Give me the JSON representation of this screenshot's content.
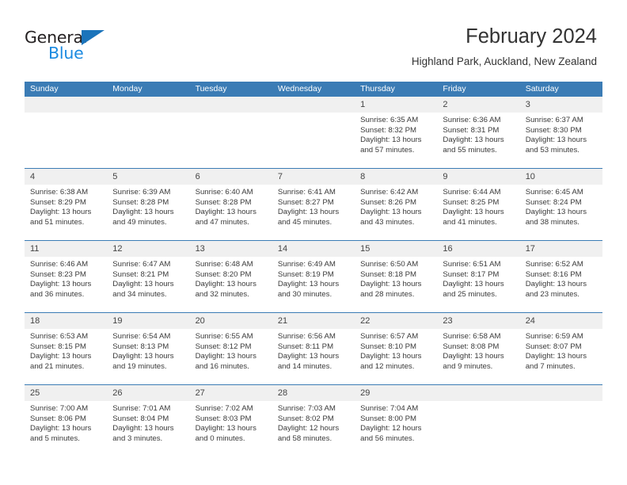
{
  "brand": {
    "name_part1": "General",
    "name_part2": "Blue",
    "accent_color": "#1b8ae0",
    "triangle_color": "#1b74bb"
  },
  "header": {
    "title": "February 2024",
    "subtitle": "Highland Park, Auckland, New Zealand"
  },
  "theme": {
    "header_blue": "#3b7cb5",
    "daynum_band": "#f0f0f0",
    "text": "#333333"
  },
  "calendar": {
    "day_headers": [
      "Sunday",
      "Monday",
      "Tuesday",
      "Wednesday",
      "Thursday",
      "Friday",
      "Saturday"
    ],
    "weeks": [
      [
        {
          "day": "",
          "lines": [
            "",
            "",
            "",
            ""
          ]
        },
        {
          "day": "",
          "lines": [
            "",
            "",
            "",
            ""
          ]
        },
        {
          "day": "",
          "lines": [
            "",
            "",
            "",
            ""
          ]
        },
        {
          "day": "",
          "lines": [
            "",
            "",
            "",
            ""
          ]
        },
        {
          "day": "1",
          "lines": [
            "Sunrise: 6:35 AM",
            "Sunset: 8:32 PM",
            "Daylight: 13 hours",
            "and 57 minutes."
          ]
        },
        {
          "day": "2",
          "lines": [
            "Sunrise: 6:36 AM",
            "Sunset: 8:31 PM",
            "Daylight: 13 hours",
            "and 55 minutes."
          ]
        },
        {
          "day": "3",
          "lines": [
            "Sunrise: 6:37 AM",
            "Sunset: 8:30 PM",
            "Daylight: 13 hours",
            "and 53 minutes."
          ]
        }
      ],
      [
        {
          "day": "4",
          "lines": [
            "Sunrise: 6:38 AM",
            "Sunset: 8:29 PM",
            "Daylight: 13 hours",
            "and 51 minutes."
          ]
        },
        {
          "day": "5",
          "lines": [
            "Sunrise: 6:39 AM",
            "Sunset: 8:28 PM",
            "Daylight: 13 hours",
            "and 49 minutes."
          ]
        },
        {
          "day": "6",
          "lines": [
            "Sunrise: 6:40 AM",
            "Sunset: 8:28 PM",
            "Daylight: 13 hours",
            "and 47 minutes."
          ]
        },
        {
          "day": "7",
          "lines": [
            "Sunrise: 6:41 AM",
            "Sunset: 8:27 PM",
            "Daylight: 13 hours",
            "and 45 minutes."
          ]
        },
        {
          "day": "8",
          "lines": [
            "Sunrise: 6:42 AM",
            "Sunset: 8:26 PM",
            "Daylight: 13 hours",
            "and 43 minutes."
          ]
        },
        {
          "day": "9",
          "lines": [
            "Sunrise: 6:44 AM",
            "Sunset: 8:25 PM",
            "Daylight: 13 hours",
            "and 41 minutes."
          ]
        },
        {
          "day": "10",
          "lines": [
            "Sunrise: 6:45 AM",
            "Sunset: 8:24 PM",
            "Daylight: 13 hours",
            "and 38 minutes."
          ]
        }
      ],
      [
        {
          "day": "11",
          "lines": [
            "Sunrise: 6:46 AM",
            "Sunset: 8:23 PM",
            "Daylight: 13 hours",
            "and 36 minutes."
          ]
        },
        {
          "day": "12",
          "lines": [
            "Sunrise: 6:47 AM",
            "Sunset: 8:21 PM",
            "Daylight: 13 hours",
            "and 34 minutes."
          ]
        },
        {
          "day": "13",
          "lines": [
            "Sunrise: 6:48 AM",
            "Sunset: 8:20 PM",
            "Daylight: 13 hours",
            "and 32 minutes."
          ]
        },
        {
          "day": "14",
          "lines": [
            "Sunrise: 6:49 AM",
            "Sunset: 8:19 PM",
            "Daylight: 13 hours",
            "and 30 minutes."
          ]
        },
        {
          "day": "15",
          "lines": [
            "Sunrise: 6:50 AM",
            "Sunset: 8:18 PM",
            "Daylight: 13 hours",
            "and 28 minutes."
          ]
        },
        {
          "day": "16",
          "lines": [
            "Sunrise: 6:51 AM",
            "Sunset: 8:17 PM",
            "Daylight: 13 hours",
            "and 25 minutes."
          ]
        },
        {
          "day": "17",
          "lines": [
            "Sunrise: 6:52 AM",
            "Sunset: 8:16 PM",
            "Daylight: 13 hours",
            "and 23 minutes."
          ]
        }
      ],
      [
        {
          "day": "18",
          "lines": [
            "Sunrise: 6:53 AM",
            "Sunset: 8:15 PM",
            "Daylight: 13 hours",
            "and 21 minutes."
          ]
        },
        {
          "day": "19",
          "lines": [
            "Sunrise: 6:54 AM",
            "Sunset: 8:13 PM",
            "Daylight: 13 hours",
            "and 19 minutes."
          ]
        },
        {
          "day": "20",
          "lines": [
            "Sunrise: 6:55 AM",
            "Sunset: 8:12 PM",
            "Daylight: 13 hours",
            "and 16 minutes."
          ]
        },
        {
          "day": "21",
          "lines": [
            "Sunrise: 6:56 AM",
            "Sunset: 8:11 PM",
            "Daylight: 13 hours",
            "and 14 minutes."
          ]
        },
        {
          "day": "22",
          "lines": [
            "Sunrise: 6:57 AM",
            "Sunset: 8:10 PM",
            "Daylight: 13 hours",
            "and 12 minutes."
          ]
        },
        {
          "day": "23",
          "lines": [
            "Sunrise: 6:58 AM",
            "Sunset: 8:08 PM",
            "Daylight: 13 hours",
            "and 9 minutes."
          ]
        },
        {
          "day": "24",
          "lines": [
            "Sunrise: 6:59 AM",
            "Sunset: 8:07 PM",
            "Daylight: 13 hours",
            "and 7 minutes."
          ]
        }
      ],
      [
        {
          "day": "25",
          "lines": [
            "Sunrise: 7:00 AM",
            "Sunset: 8:06 PM",
            "Daylight: 13 hours",
            "and 5 minutes."
          ]
        },
        {
          "day": "26",
          "lines": [
            "Sunrise: 7:01 AM",
            "Sunset: 8:04 PM",
            "Daylight: 13 hours",
            "and 3 minutes."
          ]
        },
        {
          "day": "27",
          "lines": [
            "Sunrise: 7:02 AM",
            "Sunset: 8:03 PM",
            "Daylight: 13 hours",
            "and 0 minutes."
          ]
        },
        {
          "day": "28",
          "lines": [
            "Sunrise: 7:03 AM",
            "Sunset: 8:02 PM",
            "Daylight: 12 hours",
            "and 58 minutes."
          ]
        },
        {
          "day": "29",
          "lines": [
            "Sunrise: 7:04 AM",
            "Sunset: 8:00 PM",
            "Daylight: 12 hours",
            "and 56 minutes."
          ]
        },
        {
          "day": "",
          "lines": [
            "",
            "",
            "",
            ""
          ]
        },
        {
          "day": "",
          "lines": [
            "",
            "",
            "",
            ""
          ]
        }
      ]
    ]
  }
}
